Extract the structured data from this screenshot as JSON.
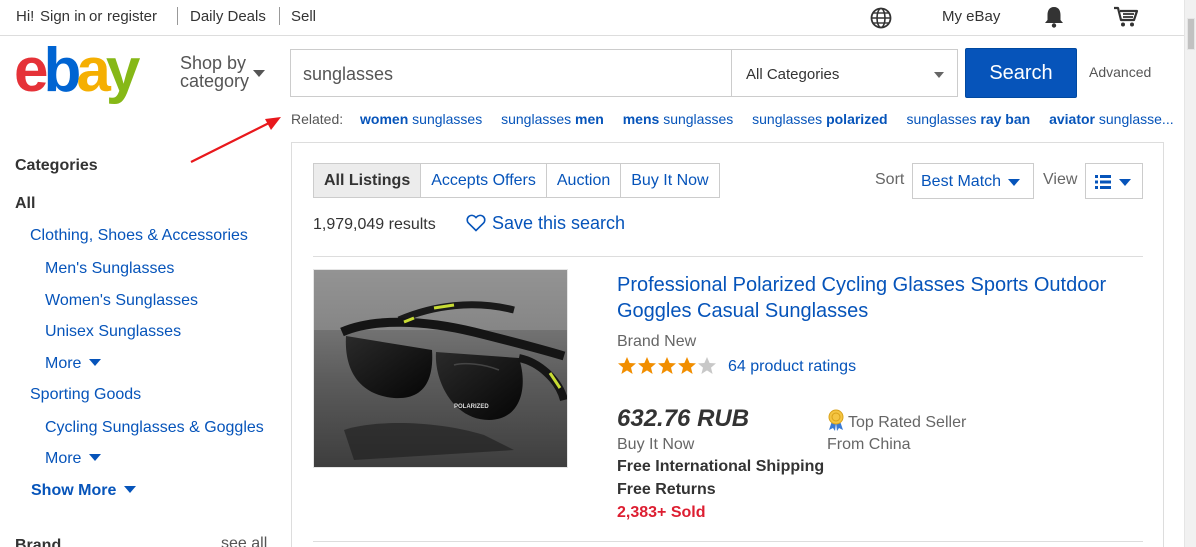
{
  "topbar": {
    "greeting": "Hi!",
    "sign_in": "Sign in",
    "or": "or",
    "register": "register",
    "daily_deals": "Daily Deals",
    "sell": "Sell",
    "my_ebay": "My eBay",
    "icons": [
      "globe-icon",
      "bell-icon",
      "cart-icon"
    ]
  },
  "header": {
    "logo": {
      "e": "e",
      "b": "b",
      "a": "a",
      "y": "y"
    },
    "shop_by_line1": "Shop by",
    "shop_by_line2": "category",
    "search_value": "sunglasses",
    "category": "All Categories",
    "search_button": "Search",
    "advanced": "Advanced"
  },
  "related": {
    "label": "Related:",
    "items": [
      {
        "bold": "women",
        "rest": " sunglasses"
      },
      {
        "pre": "sunglasses ",
        "bold": "men"
      },
      {
        "bold": "mens",
        "rest": " sunglasses"
      },
      {
        "pre": "sunglasses ",
        "bold": "polarized"
      },
      {
        "pre": "sunglasses ",
        "bold": "ray ban"
      },
      {
        "bold": "aviator",
        "rest": " sunglasse..."
      }
    ]
  },
  "sidebar": {
    "categories_title": "Categories",
    "all": "All",
    "clothing": "Clothing, Shoes & Accessories",
    "mens": "Men's Sunglasses",
    "womens": "Women's Sunglasses",
    "unisex": "Unisex Sunglasses",
    "more1": "More",
    "sporting": "Sporting Goods",
    "cycling": "Cycling Sunglasses & Goggles",
    "more2": "More",
    "show_more": "Show More",
    "brand": "Brand",
    "see_all": "see all"
  },
  "results": {
    "tabs": [
      "All Listings",
      "Accepts Offers",
      "Auction",
      "Buy It Now"
    ],
    "sort_label": "Sort",
    "sort_value": "Best Match",
    "view_label": "View",
    "count": "1,979,049 results",
    "save_search": "Save this search"
  },
  "item": {
    "title": "Professional Polarized Cycling Glasses Sports Outdoor Goggles Casual Sunglasses",
    "condition": "Brand New",
    "rating": 4,
    "rating_max": 5,
    "ratings_text": "64 product ratings",
    "price": "632.76 RUB",
    "buy_it_now": "Buy It Now",
    "shipping": "Free International Shipping",
    "returns": "Free Returns",
    "sold": "2,383+ Sold",
    "top_rated": "Top Rated Seller",
    "from": "From China",
    "lens_label": "POLARIZED"
  },
  "colors": {
    "link": "#0654ba",
    "search_button": "#0654ba",
    "sold": "#dd1e31",
    "star": "#f18e00"
  }
}
